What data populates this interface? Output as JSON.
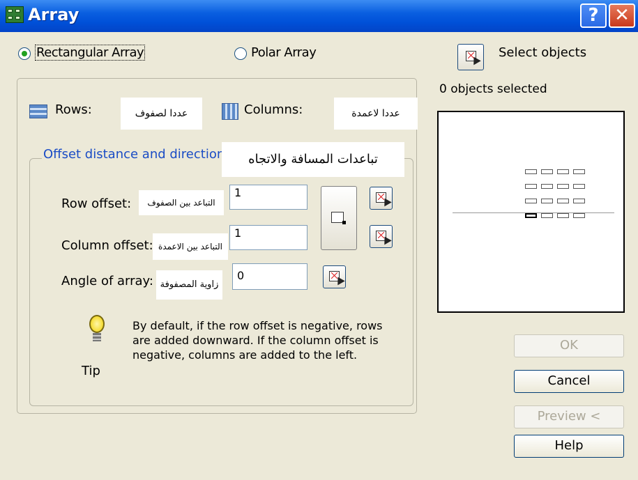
{
  "window": {
    "title": "Array",
    "help_btn": "?",
    "close_btn": "✕"
  },
  "mode": {
    "rectangular": "Rectangular Array",
    "polar": "Polar Array",
    "selected": "rectangular"
  },
  "select": {
    "label": "Select objects",
    "status": "0 objects selected"
  },
  "rows": {
    "label": "Rows:",
    "arabic": "عددا لصفوف"
  },
  "columns": {
    "label": "Columns:",
    "arabic": "عددا لاعمدة"
  },
  "offset_group": {
    "title": "Offset distance and direction",
    "arabic": "تباعدات المسافة والاتجاه"
  },
  "row_offset": {
    "label": "Row offset:",
    "arabic": "التباعد بين الصفوف",
    "value": "1"
  },
  "column_offset": {
    "label": "Column offset:",
    "arabic": "التباعد بين الاعمدة",
    "value": "1"
  },
  "angle": {
    "label": "Angle of array:",
    "arabic": "زاوية المصفوفة",
    "value": "0"
  },
  "tip": {
    "label": "Tip",
    "text": "By default, if the row offset is negative, rows are added downward. If the column offset is negative, columns are added to the left."
  },
  "buttons": {
    "ok": "OK",
    "cancel": "Cancel",
    "preview": "Preview <",
    "help": "Help"
  },
  "icons": [
    "array-app-icon",
    "help-icon",
    "close-icon",
    "rows-icon",
    "columns-icon",
    "pick-point-icon",
    "pick-both-offsets-icon",
    "tip-bulb-icon"
  ]
}
